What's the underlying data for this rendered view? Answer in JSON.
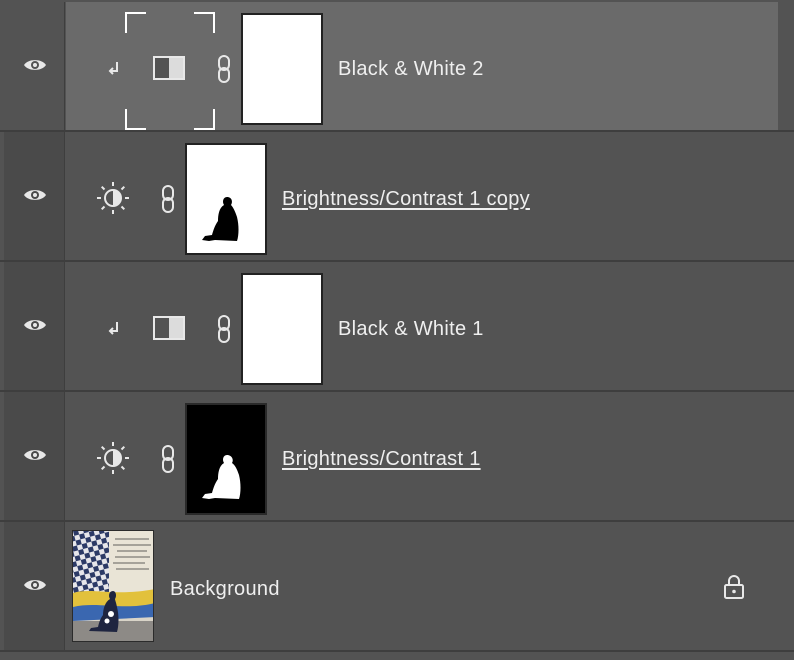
{
  "layers": [
    {
      "name": "Black & White 2",
      "type": "black-white",
      "clipped": true,
      "selected": true,
      "mask": "white",
      "underlined": false
    },
    {
      "name": "Brightness/Contrast 1 copy",
      "type": "brightness-contrast",
      "clipped": false,
      "selected": false,
      "mask": "white-with-black-figure",
      "underlined": true
    },
    {
      "name": "Black & White 1",
      "type": "black-white",
      "clipped": true,
      "selected": false,
      "mask": "white",
      "underlined": false
    },
    {
      "name": "Brightness/Contrast 1",
      "type": "brightness-contrast",
      "clipped": false,
      "selected": false,
      "mask": "black-with-white-figure",
      "underlined": true
    },
    {
      "name": "Background",
      "type": "pixel",
      "clipped": false,
      "selected": false,
      "locked": true
    }
  ],
  "icons": {
    "visibility": "eye-icon",
    "clip": "clipping-arrow-icon",
    "black_white": "black-white-adjustment-icon",
    "brightness": "brightness-contrast-icon",
    "link": "chain-link-icon",
    "lock": "lock-icon"
  },
  "colors": {
    "panel_bg": "#535353",
    "selected_row_bg": "#6a6a6a",
    "text": "#efefef"
  }
}
